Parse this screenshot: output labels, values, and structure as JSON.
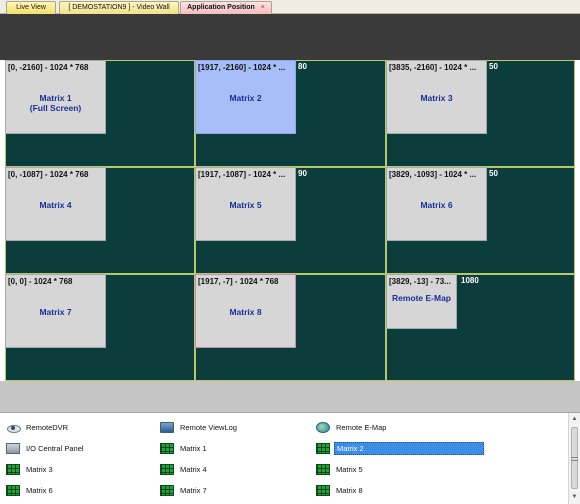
{
  "tabs": [
    {
      "label": "Live View"
    },
    {
      "label": "[ DEMOSTATION9 ] - Video Wall"
    },
    {
      "label": "Application Position",
      "close": "×"
    }
  ],
  "wall": {
    "edge_labels": [
      "80",
      "50",
      "90",
      "50",
      "1080"
    ],
    "windows": [
      {
        "coords": "[0, -2160] - 1024 * 768",
        "title": "Matrix 1",
        "subtitle": "(Full Screen)"
      },
      {
        "coords": "[1917, -2160] - 1024 * ...",
        "title": "Matrix 2"
      },
      {
        "coords": "[3835, -2160] - 1024 * ...",
        "title": "Matrix 3"
      },
      {
        "coords": "[0, -1087] - 1024 * 768",
        "title": "Matrix 4"
      },
      {
        "coords": "[1917, -1087] - 1024 * ...",
        "title": "Matrix 5"
      },
      {
        "coords": "[3829, -1093] - 1024 * ...",
        "title": "Matrix 6"
      },
      {
        "coords": "[0, 0] - 1024 * 768",
        "title": "Matrix 7"
      },
      {
        "coords": "[1917, -7] - 1024 * 768",
        "title": "Matrix 8"
      },
      {
        "coords": "[3829, -13] - 73...",
        "title": "Remote E-Map"
      }
    ]
  },
  "list": {
    "items": [
      {
        "label": "RemoteDVR",
        "icon": "eye-icon"
      },
      {
        "label": "Remote ViewLog",
        "icon": "monitor-icon"
      },
      {
        "label": "Remote E-Map",
        "icon": "globe-icon"
      },
      {
        "label": "I/O Central Panel",
        "icon": "panel-icon"
      },
      {
        "label": "Matrix 1",
        "icon": "matrix-icon"
      },
      {
        "label": "Matrix 2",
        "icon": "matrix-icon",
        "selected": true
      },
      {
        "label": "Matrix 3",
        "icon": "matrix-icon"
      },
      {
        "label": "Matrix 4",
        "icon": "matrix-icon"
      },
      {
        "label": "Matrix 5",
        "icon": "matrix-icon"
      },
      {
        "label": "Matrix 6",
        "icon": "matrix-icon"
      },
      {
        "label": "Matrix 7",
        "icon": "matrix-icon"
      },
      {
        "label": "Matrix 8",
        "icon": "matrix-icon"
      }
    ]
  },
  "colors": {
    "wall_background": "#0a3d3c",
    "cell_border": "#b8c868",
    "selected_window": "#a7bdf7",
    "window_title": "#1a2e98"
  }
}
